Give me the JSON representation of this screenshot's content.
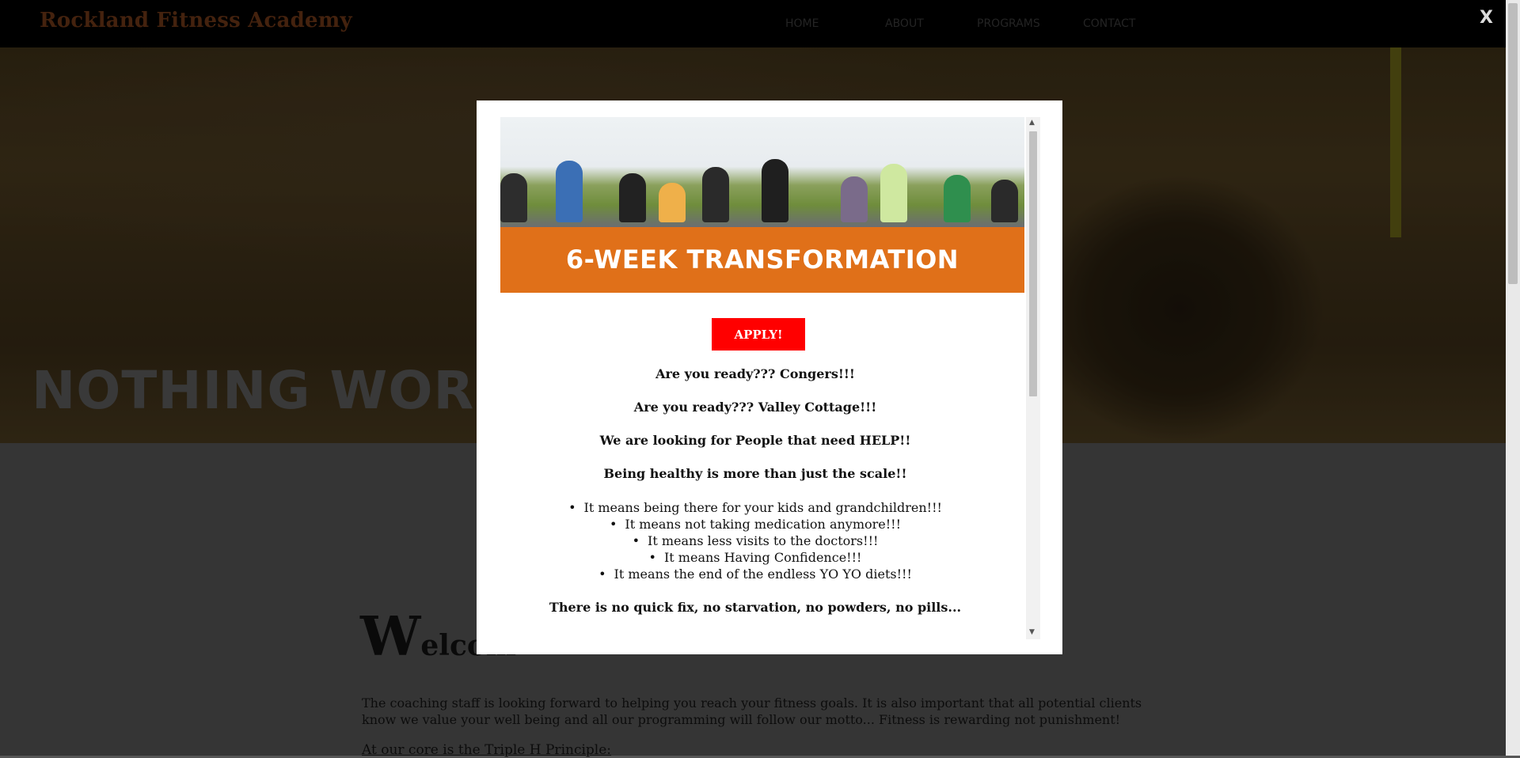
{
  "nav": {
    "brand": "Rockland Fitness Academy",
    "links": [
      "HOME",
      "ABOUT",
      "PROGRAMS",
      "CONTACT"
    ]
  },
  "hero": {
    "title": "NOTHING WORKS"
  },
  "content": {
    "welcome_cap": "W",
    "welcome_rest": "elcom",
    "intro": "The coaching staff is looking forward to helping you reach your fitness goals. It is also important that all potential clients know we value your well being and all our programming will follow our motto... Fitness is rewarding not punishment!",
    "core": "At our core is the Triple H Principle:"
  },
  "modal": {
    "close": "X",
    "banner_title": "6-WEEK TRANSFORMATION",
    "apply_label": "APPLY!",
    "lines": [
      "Are you ready??? Congers!!!",
      "Are you ready??? Valley Cottage!!!",
      "We are looking for People that need HELP!!",
      "Being healthy is more than just the scale!!"
    ],
    "bullets": [
      "It means being there for your kids and grandchildren!!!",
      "It means not taking medication anymore!!!",
      "It means less visits to the doctors!!!",
      "It means Having Confidence!!!",
      "It means the end of the endless YO YO diets!!!"
    ],
    "closing": "There is no quick fix, no starvation, no powders, no pills..."
  },
  "colors": {
    "brand": "#6e3718",
    "banner": "#e07019",
    "apply": "#ff0000"
  }
}
